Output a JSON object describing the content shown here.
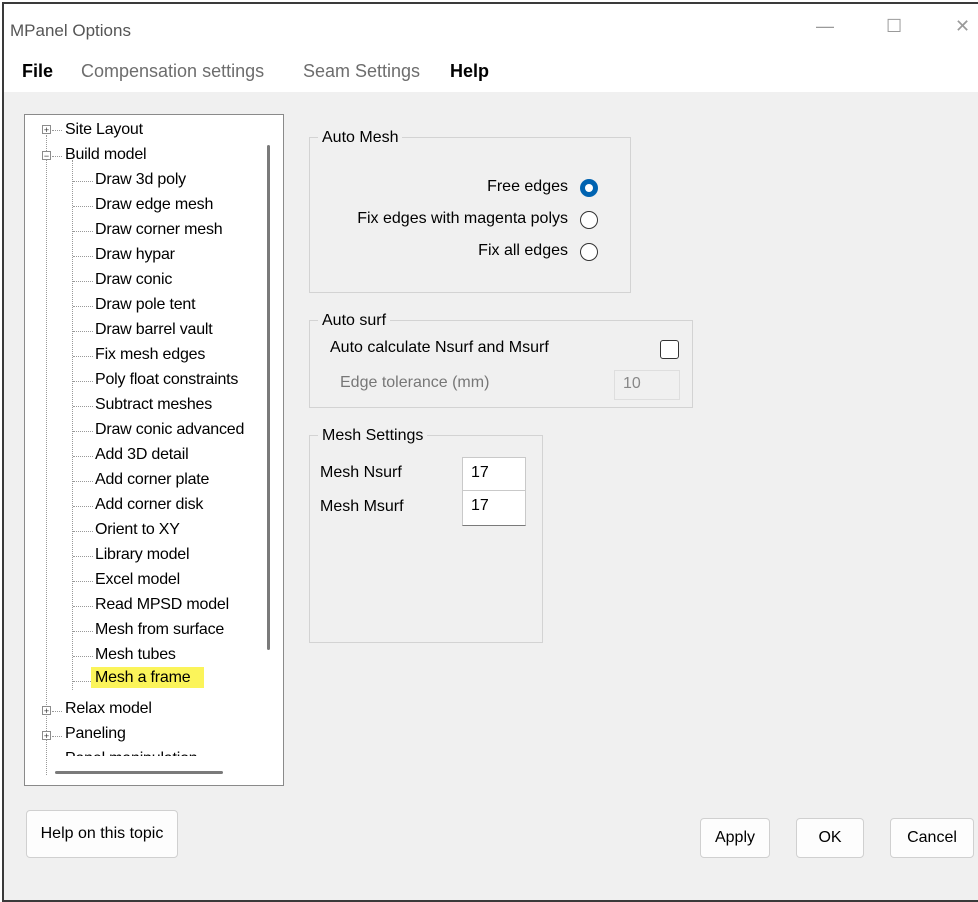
{
  "window": {
    "title": "MPanel Options",
    "minimize_icon": "—",
    "maximize_icon": "☐",
    "close_icon": "✕"
  },
  "menu": {
    "items": [
      "File",
      "Compensation settings",
      "Seam Settings",
      "Help"
    ]
  },
  "tree": {
    "site_layout": "Site Layout",
    "build_model": "Build model",
    "children": [
      "Draw 3d poly",
      "Draw edge mesh",
      "Draw corner mesh",
      "Draw hypar",
      "Draw conic",
      "Draw pole tent",
      "Draw barrel vault",
      "Fix mesh edges",
      "Poly float constraints",
      "Subtract meshes",
      "Draw conic advanced",
      "Add 3D detail",
      "Add corner plate",
      "Add corner disk",
      "Orient to XY",
      "Library model",
      "Excel model",
      "Read MPSD model",
      "Mesh from surface",
      "Mesh tubes",
      "Mesh a frame"
    ],
    "relax_model": "Relax model",
    "paneling": "Paneling",
    "partial_next": "Panel manipulation"
  },
  "auto_mesh": {
    "title": "Auto Mesh",
    "free_edges": "Free edges",
    "fix_magenta": "Fix edges with magenta polys",
    "fix_all": "Fix all edges",
    "selected": "free_edges"
  },
  "auto_surf": {
    "title": "Auto surf",
    "auto_calc_label": "Auto calculate Nsurf and Msurf",
    "auto_calc_checked": false,
    "edge_tolerance_label": "Edge tolerance (mm)",
    "edge_tolerance_value": "10"
  },
  "mesh_settings": {
    "title": "Mesh Settings",
    "nsurf_label": "Mesh Nsurf",
    "nsurf_value": "17",
    "msurf_label": "Mesh Msurf",
    "msurf_value": "17"
  },
  "buttons": {
    "help": "Help on this topic",
    "apply": "Apply",
    "ok": "OK",
    "cancel": "Cancel"
  }
}
